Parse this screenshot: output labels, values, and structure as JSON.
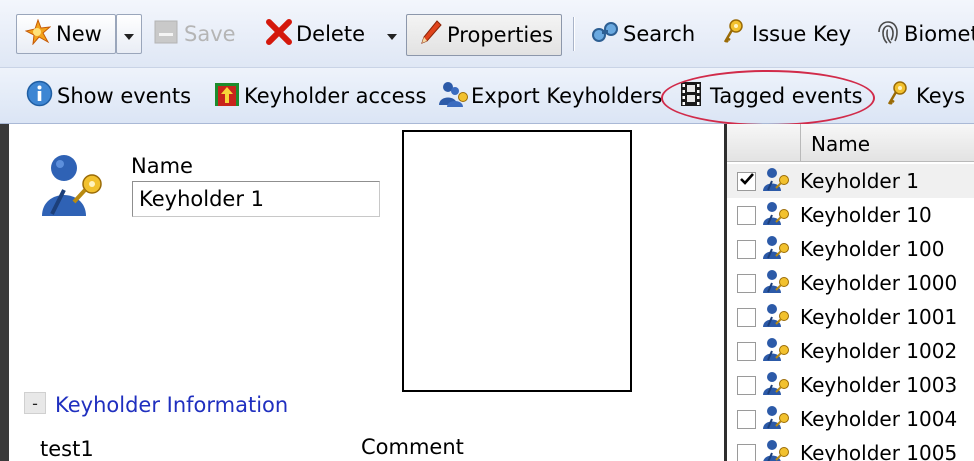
{
  "toolbar_main": {
    "new_label": "New",
    "save_label": "Save",
    "delete_label": "Delete",
    "properties_label": "Properties",
    "search_label": "Search",
    "issue_key_label": "Issue Key",
    "biometrics_label": "Biomet"
  },
  "toolbar_secondary": {
    "show_events_label": "Show events",
    "keyholder_access_label": "Keyholder access",
    "export_keyholders_label": "Export Keyholders",
    "tagged_events_label": "Tagged events",
    "keys_label": "Keys"
  },
  "form": {
    "name_label": "Name",
    "name_value": "Keyholder 1",
    "section_toggle": "-",
    "section_title": "Keyholder Information",
    "field_value_1": "test1",
    "comment_label": "Comment"
  },
  "keyholder_list": {
    "column_header": "Name",
    "rows": [
      {
        "label": "Keyholder 1",
        "checked": true
      },
      {
        "label": "Keyholder 10",
        "checked": false
      },
      {
        "label": "Keyholder 100",
        "checked": false
      },
      {
        "label": "Keyholder 1000",
        "checked": false
      },
      {
        "label": "Keyholder 1001",
        "checked": false
      },
      {
        "label": "Keyholder 1002",
        "checked": false
      },
      {
        "label": "Keyholder 1003",
        "checked": false
      },
      {
        "label": "Keyholder 1004",
        "checked": false
      },
      {
        "label": "Keyholder 1005",
        "checked": false
      }
    ]
  },
  "icons": [
    "new-icon",
    "dropdown-arrow-icon",
    "save-icon",
    "delete-x-icon",
    "properties-pencil-icon",
    "search-icon",
    "key-icon",
    "fingerprint-icon",
    "info-icon",
    "keyholder-access-icon",
    "export-keyholders-icon",
    "film-icon",
    "keyholder-icon",
    "checkmark-icon"
  ],
  "colors": {
    "toolbar_top": "#f3f6fc",
    "toolbar_bottom": "#dbe5f5",
    "section_title": "#1f2fbf",
    "annotation_ellipse": "#d12b4a"
  }
}
